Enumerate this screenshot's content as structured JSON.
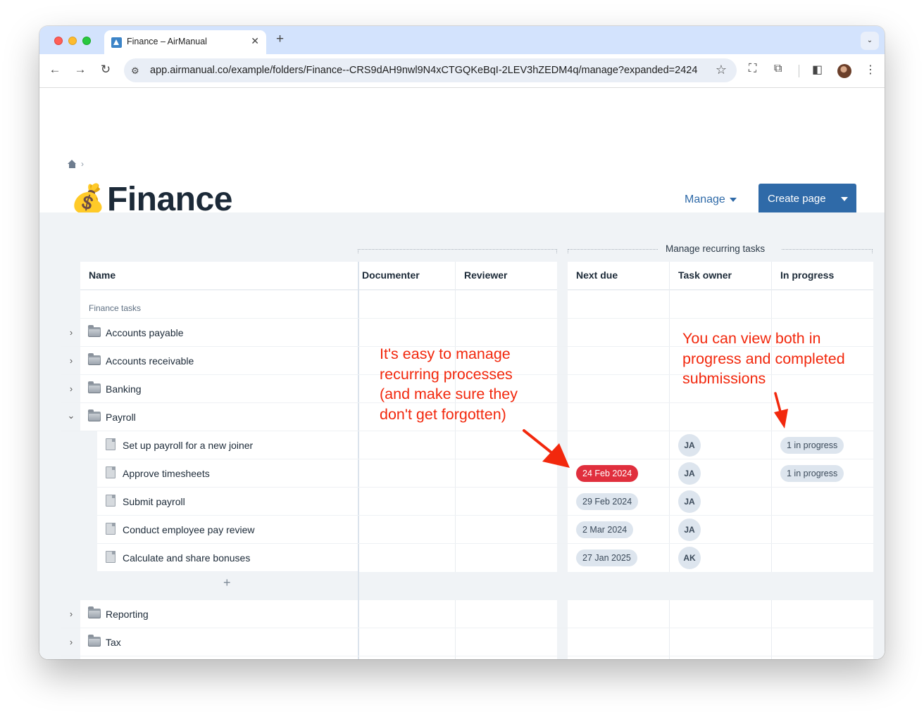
{
  "browser": {
    "tab_title": "Finance – AirManual",
    "tab_close": "✕",
    "new_tab": "+",
    "tab_menu": "⌄",
    "url": "app.airmanual.co/example/folders/Finance--CRS9dAH9nwl9N4xCTGQKeBqI-2LEV3hZEDM4q/manage?expanded=2424",
    "back": "←",
    "forward": "→",
    "reload": "↻",
    "site_info": "⚙",
    "star": "☆",
    "menu_dots": "⋮",
    "screenshot_icon": "⛶",
    "extension_icon": "⧉",
    "sidebar_icon": "◧"
  },
  "page": {
    "breadcrumb_sep": "›",
    "title_emoji": "💰",
    "title": "Finance",
    "manage_label": "Manage",
    "create_label": "Create page"
  },
  "table": {
    "group_label": "Manage recurring tasks",
    "columns": {
      "name": "Name",
      "documenter": "Documenter",
      "reviewer": "Reviewer",
      "next_due": "Next due",
      "task_owner": "Task owner",
      "in_progress": "In progress"
    },
    "section_label": "Finance tasks",
    "folders_top": [
      {
        "label": "Accounts payable",
        "expander": "›"
      },
      {
        "label": "Accounts receivable",
        "expander": "›"
      },
      {
        "label": "Banking",
        "expander": "›"
      },
      {
        "label": "Payroll",
        "expander": "⌄"
      }
    ],
    "payroll_items": [
      {
        "label": "Set up payroll for a new joiner",
        "next_due": "",
        "owner": "JA",
        "in_progress": "1 in progress"
      },
      {
        "label": "Approve timesheets",
        "next_due": "24 Feb 2024",
        "owner": "JA",
        "in_progress": "1 in progress"
      },
      {
        "label": "Submit payroll",
        "next_due": "29 Feb 2024",
        "owner": "JA",
        "in_progress": ""
      },
      {
        "label": "Conduct employee pay review",
        "next_due": "2 Mar 2024",
        "owner": "JA",
        "in_progress": ""
      },
      {
        "label": "Calculate and share bonuses",
        "next_due": "27 Jan 2025",
        "owner": "AK",
        "in_progress": ""
      }
    ],
    "add_label": "+",
    "folders_bottom": [
      {
        "label": "Reporting",
        "expander": "›"
      },
      {
        "label": "Tax",
        "expander": "›"
      }
    ]
  },
  "annotations": {
    "left": [
      "It's easy to manage",
      "recurring processes",
      "(and make sure they",
      "don't get forgotten)"
    ],
    "right": [
      "You can view both in",
      "progress and completed",
      "submissions"
    ]
  },
  "colors": {
    "accent": "#2f6aa8",
    "overdue": "#e02f3d",
    "annotation": "#f2280d"
  }
}
